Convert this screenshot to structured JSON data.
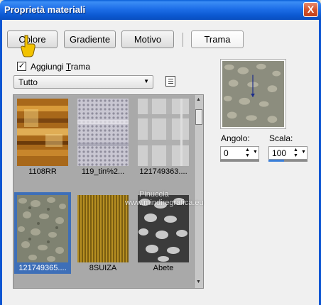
{
  "window": {
    "title": "Proprietà materiali",
    "close_label": "X"
  },
  "tabs": [
    {
      "label": "Colore"
    },
    {
      "label": "Gradiente"
    },
    {
      "label": "Motivo"
    },
    {
      "label": "Trama"
    }
  ],
  "add_texture": {
    "checked": true,
    "label_pre": "Aggiungi ",
    "label_hot": "T",
    "label_post": "rama"
  },
  "category": {
    "value": "Tutto"
  },
  "gallery": {
    "items": [
      {
        "label": "1108RR"
      },
      {
        "label": "119_tin%2..."
      },
      {
        "label": "121749363...."
      },
      {
        "label": "121749365...."
      },
      {
        "label": "8SUIZA"
      },
      {
        "label": "Abete"
      }
    ],
    "selected_index": 3
  },
  "angle": {
    "label": "Angolo:",
    "value": "0"
  },
  "scale": {
    "label": "Scala:",
    "value": "100"
  },
  "watermark": {
    "text": "Pinuccia",
    "url": "www.mindiregrafica.eu"
  },
  "colors": {
    "title_blue": "#0b55d2",
    "selection_blue": "#3e6fb8",
    "cursor_yellow": "#f2c300"
  }
}
